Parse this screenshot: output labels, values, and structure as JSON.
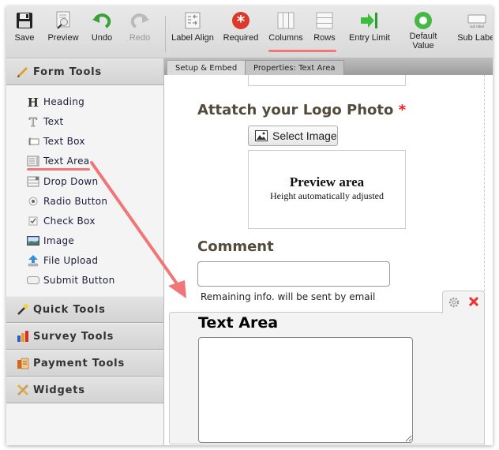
{
  "toolbar": {
    "buttons": [
      {
        "label": "Save",
        "icon": "floppy-disk"
      },
      {
        "label": "Preview",
        "icon": "preview-magnifier"
      },
      {
        "label": "Undo",
        "icon": "undo-arrow"
      },
      {
        "label": "Redo",
        "icon": "redo-arrow",
        "disabled": true
      },
      {
        "label": "Label Align",
        "icon": "label-align"
      },
      {
        "label": "Required",
        "icon": "required-asterisk"
      },
      {
        "label": "Columns",
        "icon": "columns"
      },
      {
        "label": "Rows",
        "icon": "rows"
      },
      {
        "label": "Entry Limit",
        "icon": "entry-limit-arrow"
      },
      {
        "label": "Default Value",
        "icon": "default-value-circle"
      },
      {
        "label": "Sub Label",
        "icon": "sub-label",
        "icon_text": "sub label"
      }
    ]
  },
  "sidebar": {
    "form_tools": {
      "title": "Form Tools",
      "items": [
        {
          "label": "Heading",
          "icon": "heading"
        },
        {
          "label": "Text",
          "icon": "text"
        },
        {
          "label": "Text Box",
          "icon": "text-box"
        },
        {
          "label": "Text Area",
          "icon": "text-area"
        },
        {
          "label": "Drop Down",
          "icon": "drop-down"
        },
        {
          "label": "Radio Button",
          "icon": "radio"
        },
        {
          "label": "Check Box",
          "icon": "checkbox"
        },
        {
          "label": "Image",
          "icon": "image"
        },
        {
          "label": "File Upload",
          "icon": "upload"
        },
        {
          "label": "Submit Button",
          "icon": "submit"
        }
      ]
    },
    "categories": [
      {
        "label": "Quick Tools",
        "icon": "magic-wand"
      },
      {
        "label": "Survey Tools",
        "icon": "bar-chart"
      },
      {
        "label": "Payment Tools",
        "icon": "payment"
      },
      {
        "label": "Widgets",
        "icon": "ruler-pencil"
      }
    ]
  },
  "tabs": [
    {
      "label": "Setup & Embed"
    },
    {
      "label": "Properties: Text Area"
    }
  ],
  "form": {
    "logo_label": "Attatch your Logo Photo",
    "required_mark": "*",
    "select_image_label": "Select Image",
    "preview_title": "Preview area",
    "preview_subtitle": "Height automatically adjusted",
    "comment_label": "Comment",
    "comment_value": "",
    "hint": "Remaining info. will be sent by email",
    "text_area_label": "Text Area",
    "text_area_value": ""
  },
  "colors": {
    "annotation": "#f07777",
    "label_text": "#534b3c",
    "required": "#ee2222"
  }
}
